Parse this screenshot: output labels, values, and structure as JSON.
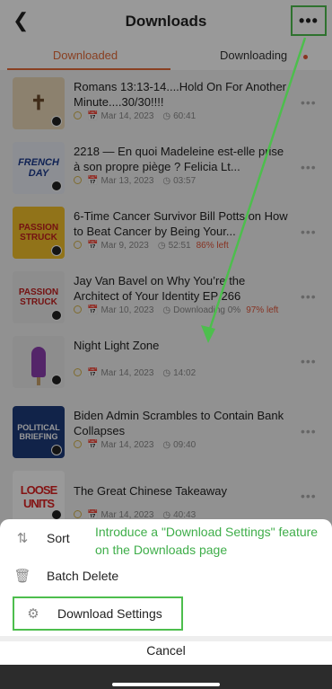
{
  "header": {
    "title": "Downloads",
    "back_icon": "chevron-left-icon",
    "more_label": "•••"
  },
  "tabs": [
    {
      "label": "Downloaded",
      "active": true
    },
    {
      "label": "Downloading",
      "active": false
    }
  ],
  "episodes": [
    {
      "title": "Romans 13:13-14....Hold On For Another Minute....30/30!!!!",
      "date": "Mar 14, 2023",
      "duration": "60:41",
      "thumb_text": ""
    },
    {
      "title": "2218 — En quoi Madeleine est-elle prise à son propre piège ? Felicia Lt...",
      "date": "Mar 13, 2023",
      "duration": "03:57",
      "thumb_text": "FRENCH DAY"
    },
    {
      "title": "6-Time Cancer Survivor Bill Potts on How to Beat Cancer by Being Your...",
      "date": "Mar 9, 2023",
      "duration": "52:51",
      "left": "86% left",
      "thumb_text": "PASSION STRUCK"
    },
    {
      "title": "Jay Van Bavel on Why You’re the Architect of Your Identity EP 266",
      "date": "Mar 10, 2023",
      "duration": "Downloading 0%",
      "left": "97% left",
      "thumb_text": "PASSION STRUCK"
    },
    {
      "title": "Night Light Zone",
      "date": "Mar 14, 2023",
      "duration": "14:02",
      "thumb_text": ""
    },
    {
      "title": "Biden Admin Scrambles to Contain Bank Collapses",
      "date": "Mar 14, 2023",
      "duration": "09:40",
      "thumb_text": "POLITICAL BRIEFING"
    },
    {
      "title": "The Great Chinese Takeaway",
      "date": "Mar 14, 2023",
      "duration": "40:43",
      "thumb_text": "LOOSE UNITS"
    }
  ],
  "sheet": {
    "sort_label": "Sort",
    "batch_delete_label": "Batch Delete",
    "download_settings_label": "Download Settings",
    "cancel_label": "Cancel"
  },
  "annotation": {
    "text": "Introduce a \"Download Settings\" feature on the Downloads page"
  },
  "colors": {
    "accent": "#e46b3a",
    "highlight": "#4dbe4d"
  }
}
